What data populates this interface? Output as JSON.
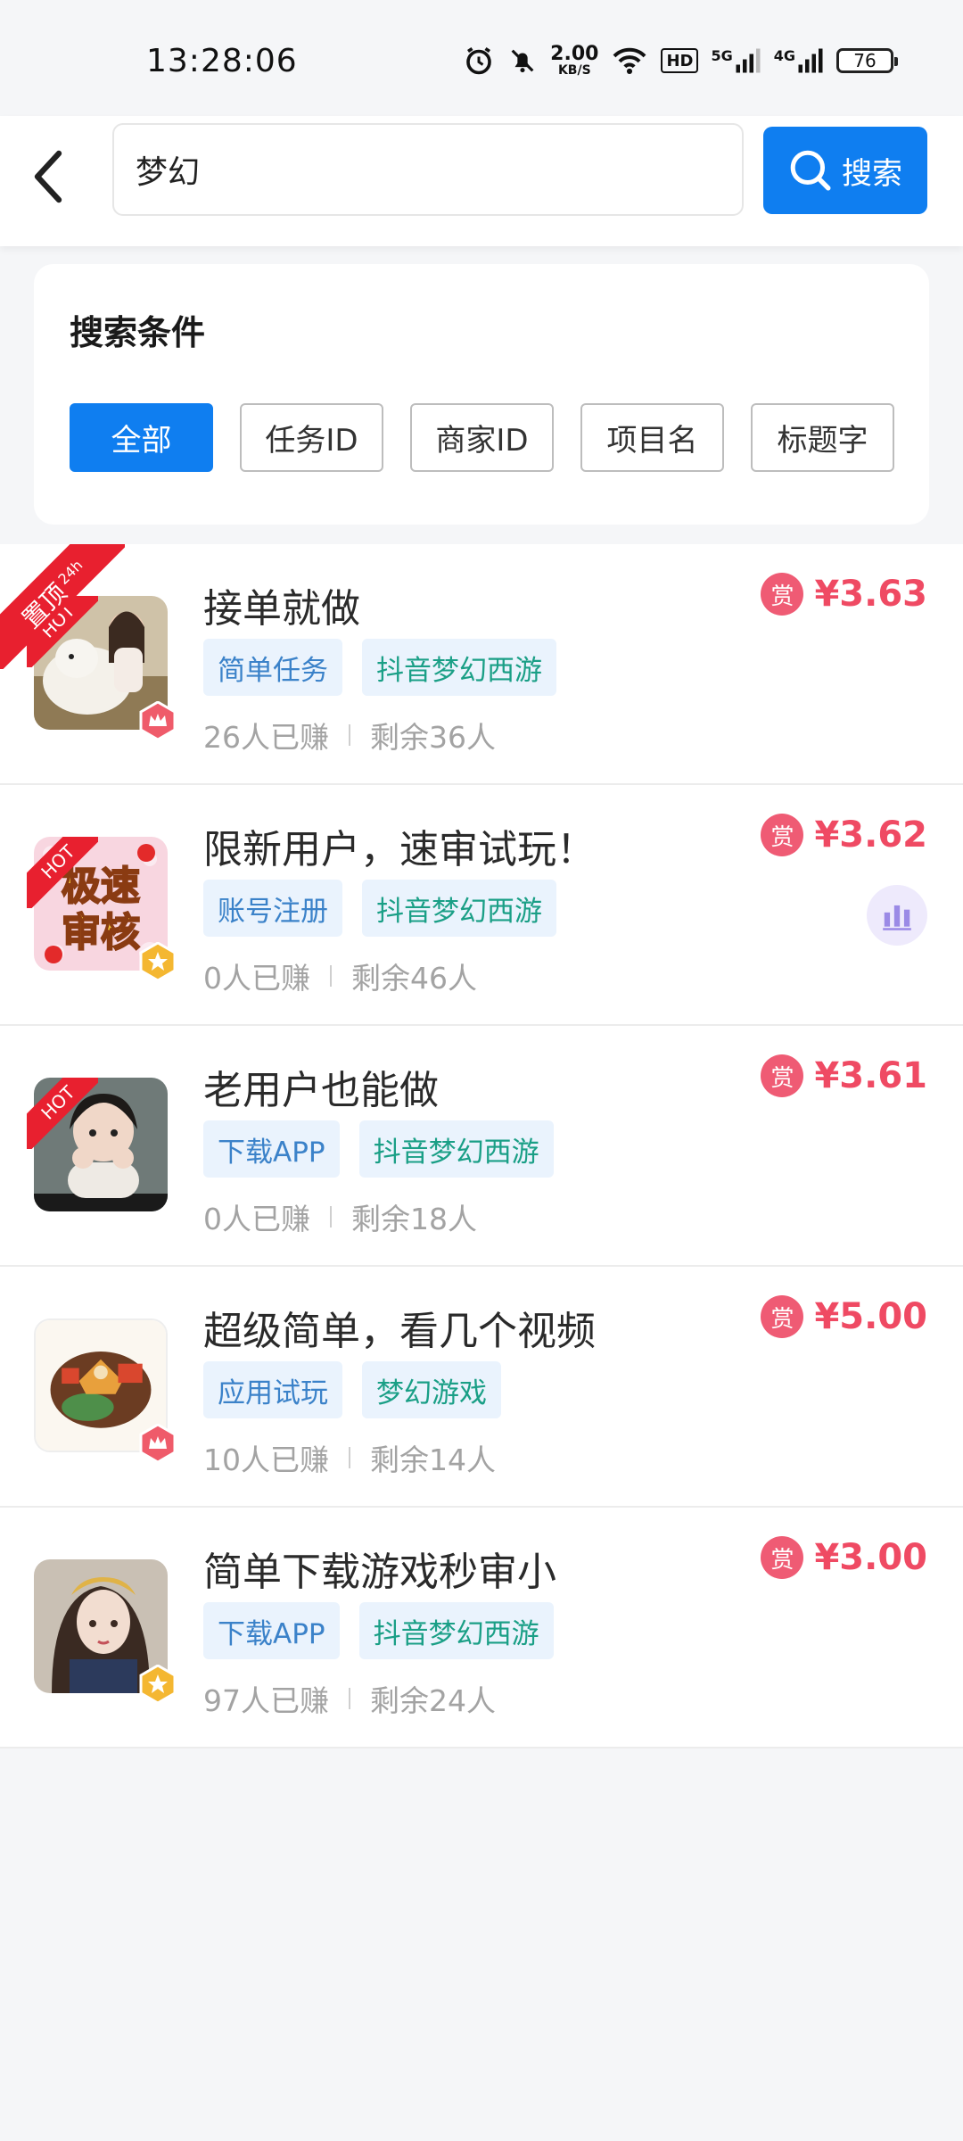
{
  "status_bar": {
    "time": "13:28:06",
    "net_speed_value": "2.00",
    "net_speed_unit": "KB/S",
    "hd_label": "HD",
    "net_5g": "5G",
    "net_4g": "4G",
    "battery": "76",
    "icons": [
      "alarm-icon",
      "mute-icon",
      "wifi-icon",
      "hd-icon",
      "signal-5g-icon",
      "signal-4g-icon",
      "battery-icon"
    ]
  },
  "header": {
    "search_value": "梦幻",
    "search_button_label": "搜索"
  },
  "filter": {
    "title": "搜索条件",
    "chips": [
      {
        "label": "全部",
        "active": true
      },
      {
        "label": "任务ID",
        "active": false
      },
      {
        "label": "商家ID",
        "active": false
      },
      {
        "label": "项目名",
        "active": false
      },
      {
        "label": "标题字",
        "active": false
      }
    ]
  },
  "tasks": [
    {
      "title": "接单就做",
      "tags": [
        "简单任务",
        "抖音梦幻西游"
      ],
      "earned": "26人已赚",
      "remaining": "剩余36人",
      "reward_icon": "赏",
      "reward": "¥3.63",
      "hot": "HOT",
      "ribbon": "置顶",
      "ribbon_sub": "24h",
      "badge": "crown"
    },
    {
      "title": "限新用户，速审试玩！",
      "tags": [
        "账号注册",
        "抖音梦幻西游"
      ],
      "earned": "0人已赚",
      "remaining": "剩余46人",
      "reward_icon": "赏",
      "reward": "¥3.62",
      "hot": "HOT",
      "thumb_text_1": "极速",
      "thumb_text_2": "审核",
      "badge": "star"
    },
    {
      "title": "老用户也能做",
      "tags": [
        "下载APP",
        "抖音梦幻西游"
      ],
      "earned": "0人已赚",
      "remaining": "剩余18人",
      "reward_icon": "赏",
      "reward": "¥3.61",
      "hot": "HOT"
    },
    {
      "title": "超级简单，看几个视频",
      "tags": [
        "应用试玩",
        "梦幻游戏"
      ],
      "earned": "10人已赚",
      "remaining": "剩余14人",
      "reward_icon": "赏",
      "reward": "¥5.00",
      "badge": "crown"
    },
    {
      "title": "简单下载游戏秒审小",
      "tags": [
        "下载APP",
        "抖音梦幻西游"
      ],
      "earned": "97人已赚",
      "remaining": "剩余24人",
      "reward_icon": "赏",
      "reward": "¥3.00",
      "badge": "star"
    }
  ],
  "colors": {
    "primary": "#0f7ef0",
    "reward": "#ef4a63",
    "hot": "#e8202f",
    "tag_bg": "#eaf3fd",
    "tag_text": "#3b82c9",
    "tag_game_text": "#1a9f86"
  }
}
